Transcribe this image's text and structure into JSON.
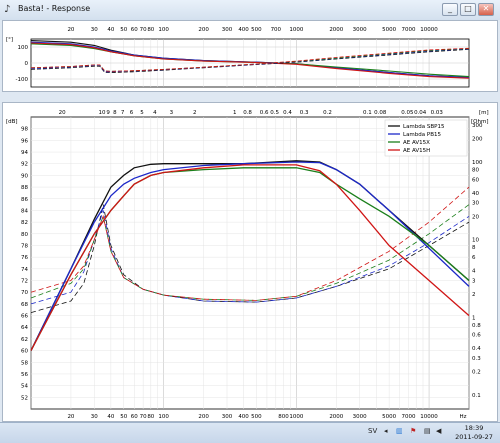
{
  "window": {
    "title": "Basta! - Response",
    "icon": "basta-icon"
  },
  "window_buttons": {
    "minimize": "_",
    "maximize": "□",
    "close": "✕"
  },
  "phase_panel": {
    "unit": "[°]",
    "top_ticks": [
      "20",
      "30",
      "40",
      "50",
      "60",
      "70",
      "80",
      "100",
      "200",
      "300",
      "400",
      "500",
      "700",
      "1000",
      "2000",
      "3000",
      "5000",
      "7000",
      "10000"
    ],
    "y_ticks": [
      "100",
      "0",
      "-100"
    ]
  },
  "main_panel": {
    "unit_left": "[dB]",
    "unit_right": "[Ohm]",
    "unit_top_right": "[m]",
    "brand": "Basta!",
    "top_ticks": [
      "20",
      "10",
      "9",
      "8",
      "7",
      "6",
      "5",
      "4",
      "3",
      "2",
      "1",
      "0.8",
      "0.6",
      "0.5",
      "0.4",
      "0.3",
      "0.2",
      "0.1",
      "0.08",
      "0.05",
      "0.04",
      "0.03"
    ],
    "y_ticks_left": [
      "98",
      "96",
      "94",
      "92",
      "90",
      "88",
      "86",
      "84",
      "82",
      "80",
      "78",
      "76",
      "74",
      "72",
      "70",
      "68",
      "66",
      "64",
      "62",
      "60",
      "58",
      "56",
      "54",
      "52"
    ],
    "y_ticks_right": [
      "300",
      "200",
      "100",
      "80",
      "60",
      "40",
      "30",
      "20",
      "10",
      "8",
      "6",
      "4",
      "3",
      "2",
      "1",
      "0.8",
      "0.6",
      "0.4",
      "0.3",
      "0.2",
      "0.1"
    ],
    "x_ticks": [
      "20",
      "30",
      "40",
      "50",
      "60",
      "70",
      "80",
      "100",
      "200",
      "300",
      "400",
      "500",
      "800",
      "1000",
      "2000",
      "3000",
      "5000",
      "7000",
      "10000",
      "Hz"
    ]
  },
  "chart_data": {
    "type": "line",
    "title": "",
    "xlabel": "Hz",
    "ylabel": "dB",
    "xscale": "log",
    "xlim": [
      10,
      20000
    ],
    "ylim": [
      50,
      100
    ],
    "grid": true,
    "legend_position": "top-right",
    "series": [
      {
        "name": "Lambda SBP15",
        "color": "#111111",
        "x": [
          10,
          20,
          30,
          40,
          50,
          60,
          80,
          100,
          200,
          400,
          1000,
          1500,
          2000,
          3000,
          5000,
          10000,
          20000
        ],
        "y": [
          60,
          74,
          82.5,
          88,
          90,
          91.3,
          91.9,
          92,
          92,
          92,
          92.5,
          92.3,
          91,
          88.5,
          84,
          78,
          72
        ]
      },
      {
        "name": "Lambda PB15",
        "color": "#1c28c8",
        "x": [
          10,
          20,
          30,
          40,
          50,
          60,
          80,
          100,
          200,
          400,
          1000,
          1500,
          2000,
          3000,
          5000,
          10000,
          20000
        ],
        "y": [
          60,
          74,
          82,
          86.5,
          88.5,
          89.5,
          90.5,
          91,
          91.7,
          92,
          92.3,
          92.2,
          91,
          88.5,
          84,
          77.5,
          71
        ]
      },
      {
        "name": "AE AV15X",
        "color": "#1b7f1b",
        "x": [
          10,
          20,
          30,
          40,
          50,
          60,
          80,
          100,
          200,
          400,
          1000,
          1500,
          2000,
          3000,
          5000,
          10000,
          20000
        ],
        "y": [
          60,
          73,
          80,
          84,
          86.5,
          88.5,
          90,
          90.5,
          91,
          91.3,
          91.3,
          90.5,
          88.5,
          86,
          83,
          78,
          72
        ]
      },
      {
        "name": "AE AV15H",
        "color": "#d01515",
        "x": [
          10,
          20,
          30,
          40,
          50,
          60,
          80,
          100,
          200,
          400,
          1000,
          1500,
          2000,
          3000,
          5000,
          10000,
          20000
        ],
        "y": [
          60,
          73,
          80,
          84,
          86.5,
          88.5,
          90,
          90.5,
          91.3,
          91.8,
          91.8,
          90.8,
          88.5,
          84,
          78,
          72,
          66
        ]
      }
    ],
    "impedance_series": [
      {
        "name": "Lambda SBP15",
        "color": "#111111",
        "x": [
          10,
          20,
          25,
          30,
          35,
          40,
          50,
          70,
          100,
          200,
          500,
          1000,
          2000,
          5000,
          10000,
          20000
        ],
        "y": [
          66.5,
          68.5,
          71.5,
          78,
          85,
          78,
          73,
          70.5,
          69.5,
          68.5,
          68.3,
          69,
          71,
          74,
          78,
          82
        ]
      },
      {
        "name": "Lambda PB15",
        "color": "#1c28c8",
        "x": [
          10,
          20,
          25,
          30,
          35,
          40,
          50,
          70,
          100,
          200,
          500,
          1000,
          2000,
          5000,
          10000,
          20000
        ],
        "y": [
          68,
          70,
          73.5,
          79,
          84,
          77.5,
          72.5,
          70.5,
          69.5,
          68.5,
          68.3,
          69,
          71,
          74.5,
          78.5,
          83
        ]
      },
      {
        "name": "AE AV15X",
        "color": "#1b7f1b",
        "x": [
          10,
          20,
          25,
          30,
          35,
          40,
          50,
          70,
          100,
          200,
          500,
          1000,
          2000,
          5000,
          10000,
          20000
        ],
        "y": [
          69,
          71.5,
          74,
          79,
          83,
          77,
          72.5,
          70.5,
          69.5,
          68.8,
          68.6,
          69.3,
          71.5,
          75.5,
          80,
          85
        ]
      },
      {
        "name": "AE AV15H",
        "color": "#d01515",
        "x": [
          10,
          20,
          25,
          30,
          35,
          40,
          50,
          70,
          100,
          200,
          500,
          1000,
          2000,
          5000,
          10000,
          20000
        ],
        "y": [
          70,
          72,
          74.5,
          79,
          83,
          77,
          72.5,
          70.5,
          69.5,
          68.8,
          68.6,
          69.3,
          72,
          77,
          82,
          88
        ]
      }
    ],
    "phase_series": [
      {
        "name": "Lambda SBP15",
        "color": "#111111",
        "x": [
          10,
          20,
          30,
          40,
          60,
          100,
          200,
          500,
          1000,
          2000,
          5000,
          10000,
          20000
        ],
        "y": [
          140,
          130,
          110,
          80,
          50,
          30,
          15,
          5,
          -5,
          -30,
          -60,
          -80,
          -90
        ]
      },
      {
        "name": "Lambda PB15",
        "color": "#1c28c8",
        "x": [
          10,
          20,
          30,
          40,
          60,
          100,
          200,
          500,
          1000,
          2000,
          5000,
          10000,
          20000
        ],
        "y": [
          130,
          120,
          100,
          75,
          50,
          30,
          15,
          5,
          -5,
          -30,
          -60,
          -80,
          -90
        ]
      },
      {
        "name": "AE AV15X",
        "color": "#1b7f1b",
        "x": [
          10,
          20,
          30,
          40,
          60,
          100,
          200,
          500,
          1000,
          2000,
          5000,
          10000,
          20000
        ],
        "y": [
          120,
          110,
          90,
          70,
          45,
          25,
          12,
          3,
          -5,
          -25,
          -50,
          -70,
          -85
        ]
      },
      {
        "name": "AE AV15H",
        "color": "#d01515",
        "x": [
          10,
          20,
          30,
          40,
          60,
          100,
          200,
          500,
          1000,
          2000,
          5000,
          10000,
          20000
        ],
        "y": [
          125,
          115,
          95,
          70,
          45,
          25,
          12,
          3,
          -8,
          -35,
          -65,
          -85,
          -95
        ]
      }
    ],
    "phase_dashed_series": [
      {
        "name": "Lambda SBP15",
        "color": "#111111",
        "x": [
          10,
          20,
          30,
          33,
          36,
          40,
          60,
          100,
          200,
          500,
          1000,
          2000,
          5000,
          10000,
          20000
        ],
        "y": [
          -40,
          -30,
          -20,
          -20,
          -60,
          -60,
          -55,
          -45,
          -30,
          -10,
          5,
          25,
          50,
          70,
          85
        ]
      },
      {
        "name": "Lambda PB15",
        "color": "#1c28c8",
        "x": [
          10,
          20,
          30,
          33,
          36,
          40,
          60,
          100,
          200,
          500,
          1000,
          2000,
          5000,
          10000,
          20000
        ],
        "y": [
          -35,
          -25,
          -15,
          -15,
          -55,
          -55,
          -50,
          -42,
          -28,
          -8,
          8,
          28,
          55,
          75,
          88
        ]
      },
      {
        "name": "AE AV15X",
        "color": "#1b7f1b",
        "x": [
          10,
          20,
          30,
          33,
          36,
          40,
          60,
          100,
          200,
          500,
          1000,
          2000,
          5000,
          10000,
          20000
        ],
        "y": [
          -30,
          -22,
          -12,
          -12,
          -50,
          -52,
          -48,
          -40,
          -26,
          -6,
          10,
          30,
          58,
          78,
          90
        ]
      },
      {
        "name": "AE AV15H",
        "color": "#d01515",
        "x": [
          10,
          20,
          30,
          33,
          36,
          40,
          60,
          100,
          200,
          500,
          1000,
          2000,
          5000,
          10000,
          20000
        ],
        "y": [
          -30,
          -22,
          -12,
          -12,
          -50,
          -52,
          -48,
          -40,
          -26,
          -6,
          12,
          35,
          62,
          82,
          92
        ]
      }
    ]
  },
  "taskbar": {
    "language": "SV",
    "time": "18:39",
    "date": "2011-09-27"
  }
}
